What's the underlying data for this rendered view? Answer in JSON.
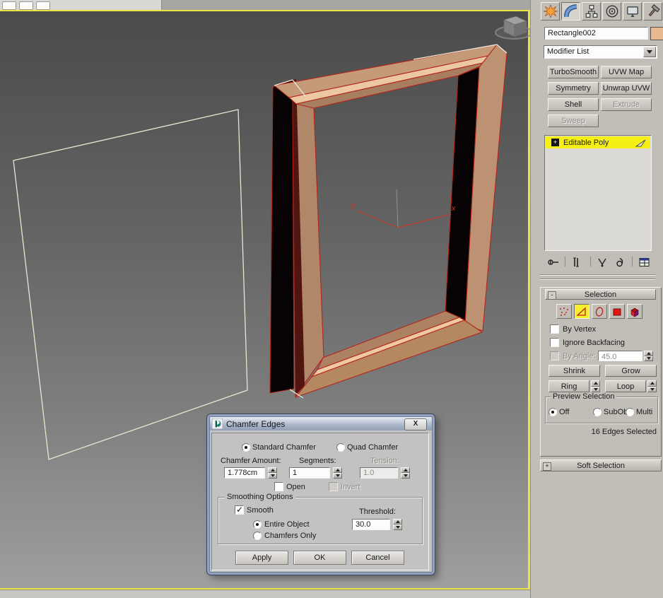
{
  "panel": {
    "tabs": [
      {
        "name": "create"
      },
      {
        "name": "modify"
      },
      {
        "name": "hierarchy"
      },
      {
        "name": "motion"
      },
      {
        "name": "display"
      },
      {
        "name": "utilities"
      }
    ],
    "active_tab": "modify",
    "object_name": "Rectangle002",
    "object_color": "#eab88e",
    "modifier_list_label": "Modifier List",
    "modifier_buttons": [
      {
        "label": "TurboSmooth",
        "enabled": true
      },
      {
        "label": "UVW Map",
        "enabled": true
      },
      {
        "label": "Symmetry",
        "enabled": true
      },
      {
        "label": "Unwrap UVW",
        "enabled": true
      },
      {
        "label": "Shell",
        "enabled": true
      },
      {
        "label": "Extrude",
        "enabled": false
      },
      {
        "label": "Sweep",
        "enabled": false
      }
    ],
    "stack": {
      "item": "Editable Poly",
      "expand_glyph": "+"
    },
    "selection": {
      "title": "Selection",
      "collapse_glyph": "-",
      "modes": [
        "vertex",
        "edge",
        "border",
        "polygon",
        "element"
      ],
      "active_mode": "edge",
      "by_vertex": "By Vertex",
      "ignore_backfacing": "Ignore Backfacing",
      "by_angle": "By Angle:",
      "angle_value": "45.0",
      "shrink": "Shrink",
      "grow": "Grow",
      "ring": "Ring",
      "loop": "Loop",
      "preview": {
        "title": "Preview Selection",
        "options": [
          "Off",
          "SubObj",
          "Multi"
        ],
        "selected": "Off"
      },
      "status": "16 Edges Selected"
    },
    "soft_selection": {
      "title": "Soft Selection",
      "expand_glyph": "+"
    }
  },
  "dialog": {
    "title": "Chamfer Edges",
    "close_glyph": "X",
    "chamfer_type": {
      "options": [
        "Standard Chamfer",
        "Quad Chamfer"
      ],
      "selected": "Standard Chamfer"
    },
    "chamfer_amount_label": "Chamfer Amount:",
    "chamfer_amount": "1.778cm",
    "segments_label": "Segments:",
    "segments": "1",
    "tension_label": "Tension:",
    "tension": "1.0",
    "open_label": "Open",
    "invert_label": "Invert",
    "smoothing": {
      "title": "Smoothing Options",
      "smooth_label": "Smooth",
      "smooth_checked": true,
      "scope_options": [
        "Entire Object",
        "Chamfers Only"
      ],
      "scope_selected": "Entire Object",
      "threshold_label": "Threshold:",
      "threshold": "30.0"
    },
    "buttons": [
      "Apply",
      "OK",
      "Cancel"
    ]
  },
  "viewport": {
    "axis_x": "x",
    "axis_y": "y",
    "selection_color": "#b5241a",
    "viewport_border_color": "#e9e73f"
  }
}
